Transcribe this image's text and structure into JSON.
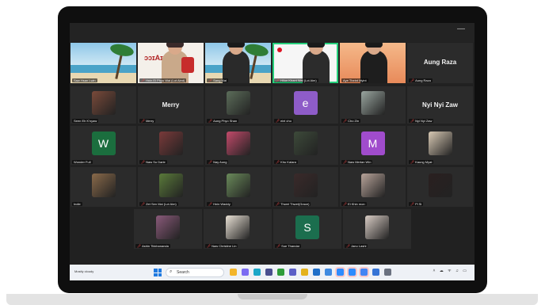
{
  "taskbar": {
    "weather": "Mostly cloudy",
    "search_placeholder": "Search",
    "app_icons": [
      {
        "name": "file-explorer-icon",
        "color": "#f3b52a"
      },
      {
        "name": "copilot-icon",
        "color": "#7b6cf2"
      },
      {
        "name": "edge-icon",
        "color": "#1aa7c8"
      },
      {
        "name": "app-icon",
        "color": "#4a4f8f"
      },
      {
        "name": "xbox-icon",
        "color": "#2e9c3a"
      },
      {
        "name": "teams-icon",
        "color": "#5b5fc7"
      },
      {
        "name": "chrome-icon",
        "color": "#e4b21c"
      },
      {
        "name": "outlook-icon",
        "color": "#1f6fc9"
      },
      {
        "name": "photos-icon",
        "color": "#3f8ae0"
      },
      {
        "name": "zoom-icon",
        "color": "#2d8cff",
        "active": true
      },
      {
        "name": "zoom-meeting-icon",
        "color": "#2d8cff",
        "active": true
      },
      {
        "name": "chrome-profile-icon",
        "color": "#4285f4",
        "active": true
      },
      {
        "name": "store-icon",
        "color": "#3674d6"
      },
      {
        "name": "settings-icon",
        "color": "#6b7280"
      }
    ]
  },
  "participants": [
    {
      "label": "Saw Hsan Lwin",
      "kind": "beach",
      "mic_muted": false
    },
    {
      "label": "Hnin Ei Phyu Wai (Lot Aimt)",
      "kind": "poster",
      "mic_muted": true
    },
    {
      "label": "Sang Mai",
      "kind": "beach-person",
      "mic_muted": true
    },
    {
      "label": "Hilun Khant Wai (Lot Aim)",
      "kind": "speaker",
      "mic_muted": true,
      "active": true
    },
    {
      "label": "Aye Theint Myint",
      "kind": "sunset-person",
      "mic_muted": false
    },
    {
      "label": "Aung Raza",
      "kind": "name",
      "big": "Aung Raza",
      "mic_muted": true
    },
    {
      "label": "Seen Eh K'nyaw",
      "kind": "avatar",
      "color": "#7a4a3a",
      "mic_muted": false
    },
    {
      "label": "Merry",
      "kind": "name",
      "big": "Merry",
      "mic_muted": true
    },
    {
      "label": "Aung Phyo Shan",
      "kind": "avatar",
      "color": "#5c6d5a",
      "mic_muted": true
    },
    {
      "label": "eiei cho",
      "kind": "letter",
      "letter": "e",
      "color": "#8e5cc8",
      "mic_muted": true
    },
    {
      "label": "Cho Zin",
      "kind": "avatar",
      "color": "#9aa6a0",
      "mic_muted": true
    },
    {
      "label": "Nyi Nyi Zaw",
      "kind": "name",
      "big": "Nyi Nyi Zaw",
      "mic_muted": true
    },
    {
      "label": "Wonder Full",
      "kind": "letter",
      "letter": "W",
      "color": "#1b6e3e",
      "mic_muted": false
    },
    {
      "label": "Naw Su Darle",
      "kind": "avatar",
      "color": "#7a3a3a",
      "mic_muted": true
    },
    {
      "label": "Nay Aung",
      "kind": "avatar",
      "color": "#c24a6a",
      "mic_muted": true
    },
    {
      "label": "Khu Kalara",
      "kind": "avatar",
      "color": "#3d4a3a",
      "mic_muted": true
    },
    {
      "label": "Naw Merlan Win",
      "kind": "letter",
      "letter": "M",
      "color": "#a04ccc",
      "mic_muted": true
    },
    {
      "label": "Kaung Myat",
      "kind": "avatar",
      "color": "#d8c9b4",
      "mic_muted": true
    },
    {
      "label": "Indie",
      "kind": "avatar",
      "color": "#8a6a4a",
      "mic_muted": false
    },
    {
      "label": "Zet Sen Mai (Lot Aim)",
      "kind": "avatar",
      "color": "#5a7a3a",
      "mic_muted": true
    },
    {
      "label": "Hnin Waddy",
      "kind": "avatar",
      "color": "#6a8a5a",
      "mic_muted": true
    },
    {
      "label": "Thwet Thwet(Grace)",
      "kind": "avatar",
      "color": "#3a2a2a",
      "mic_muted": true
    },
    {
      "label": "Ei Khin mon",
      "kind": "avatar",
      "color": "#b8a49a",
      "mic_muted": true
    },
    {
      "label": "Pi Si",
      "kind": "avatar",
      "color": "#2a2020",
      "mic_muted": true
    },
    {
      "label": "Ashin Tikkhananda",
      "kind": "avatar",
      "color": "#8a5a7a",
      "mic_muted": true
    },
    {
      "label": "Naw Christine Lin",
      "kind": "avatar",
      "color": "#e8e0d4",
      "mic_muted": true
    },
    {
      "label": "Sue Thandar",
      "kind": "letter",
      "letter": "S",
      "color": "#1b6e4e",
      "mic_muted": true
    },
    {
      "label": "Janu Lashi",
      "kind": "avatar",
      "color": "#d8ccc4",
      "mic_muted": true
    }
  ]
}
